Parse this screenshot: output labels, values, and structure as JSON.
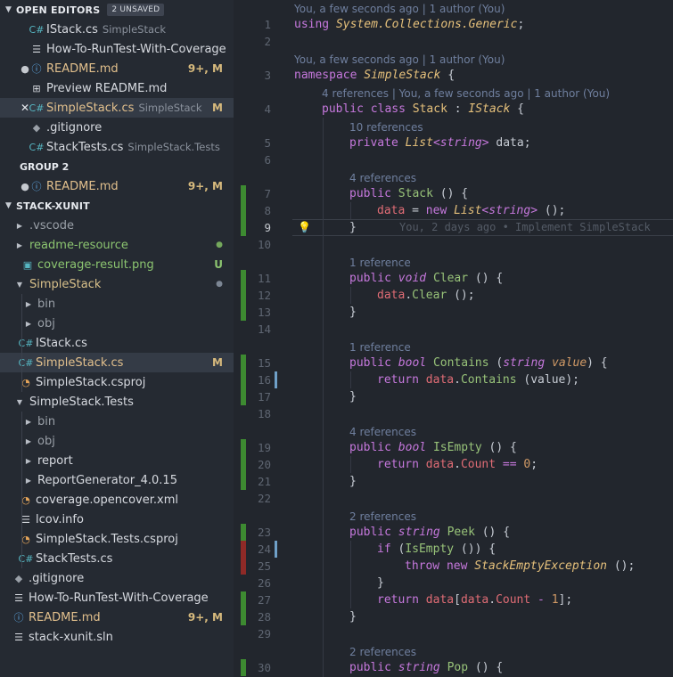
{
  "open_editors": {
    "title": "OPEN EDITORS",
    "badge": "2 UNSAVED",
    "items": [
      {
        "label": "IStack.cs",
        "desc": "SimpleStack",
        "icon": "csharp-icon"
      },
      {
        "label": "How-To-RunTest-With-Coverage",
        "desc": "",
        "icon": "text-file-icon"
      },
      {
        "label": "README.md",
        "desc": "",
        "status": "9+, M",
        "icon": "info-icon"
      },
      {
        "label": "Preview README.md",
        "desc": "",
        "icon": "preview-icon"
      },
      {
        "label": "SimpleStack.cs",
        "desc": "SimpleStack",
        "status": "M",
        "icon": "csharp-icon"
      },
      {
        "label": ".gitignore",
        "desc": "",
        "icon": "git-icon"
      },
      {
        "label": "StackTests.cs",
        "desc": "SimpleStack.Tests",
        "icon": "csharp-icon"
      }
    ],
    "group2": {
      "title": "GROUP 2",
      "items": [
        {
          "label": "README.md",
          "status": "9+, M"
        }
      ]
    }
  },
  "explorer": {
    "title": "STACK-XUNIT",
    "items": [
      {
        "label": ".vscode"
      },
      {
        "label": "readme-resource"
      },
      {
        "label": "coverage-result.png",
        "status": "U"
      },
      {
        "label": "SimpleStack"
      },
      {
        "label": "bin"
      },
      {
        "label": "obj"
      },
      {
        "label": "IStack.cs"
      },
      {
        "label": "SimpleStack.cs",
        "status": "M"
      },
      {
        "label": "SimpleStack.csproj"
      },
      {
        "label": "SimpleStack.Tests"
      },
      {
        "label": "bin"
      },
      {
        "label": "obj"
      },
      {
        "label": "report"
      },
      {
        "label": "ReportGenerator_4.0.15"
      },
      {
        "label": "coverage.opencover.xml"
      },
      {
        "label": "lcov.info"
      },
      {
        "label": "SimpleStack.Tests.csproj"
      },
      {
        "label": "StackTests.cs"
      },
      {
        "label": ".gitignore"
      },
      {
        "label": "How-To-RunTest-With-Coverage"
      },
      {
        "label": "README.md",
        "status": "9+, M"
      },
      {
        "label": "stack-xunit.sln"
      }
    ]
  },
  "editor": {
    "lens": {
      "l1": "You, a few seconds ago | 1 author (You)",
      "l3": "You, a few seconds ago | 1 author (You)",
      "l4": "4 references | You, a few seconds ago | 1 author (You)",
      "l5": "10 references",
      "l7": "4 references",
      "l11": "1 reference",
      "l15": "1 reference",
      "l19": "4 references",
      "l23": "2 references",
      "l30": "2 references"
    },
    "blame9": "You, 2 days ago • Implement SimpleStack",
    "line_numbers": [
      "1",
      "2",
      "3",
      "4",
      "5",
      "6",
      "7",
      "8",
      "9",
      "10",
      "11",
      "12",
      "13",
      "14",
      "15",
      "16",
      "17",
      "18",
      "19",
      "20",
      "21",
      "22",
      "23",
      "24",
      "25",
      "26",
      "27",
      "28",
      "29",
      "30"
    ],
    "code": {
      "l1": [
        "using",
        " ",
        "System.Collections.Generic",
        ";"
      ],
      "l3": [
        "namespace",
        " ",
        "SimpleStack",
        " {"
      ],
      "l4": [
        "public",
        " ",
        "class",
        " ",
        "Stack",
        " : ",
        "IStack",
        " {"
      ],
      "l5": [
        "private",
        " ",
        "List",
        "<",
        "string",
        ">",
        " data;"
      ],
      "l7": [
        "public",
        " ",
        "Stack",
        " () {"
      ],
      "l8": [
        "data",
        " = ",
        "new",
        " ",
        "List",
        "<",
        "string",
        ">",
        " ();"
      ],
      "l9": [
        "}"
      ],
      "l11": [
        "public",
        " ",
        "void",
        " ",
        "Clear",
        " () {"
      ],
      "l12": [
        "data",
        ".",
        "Clear",
        " ();"
      ],
      "l13": [
        "}"
      ],
      "l15": [
        "public",
        " ",
        "bool",
        " ",
        "Contains",
        " (",
        "string",
        " ",
        "value",
        ") {"
      ],
      "l16": [
        "return",
        " ",
        "data",
        ".",
        "Contains",
        " (value);"
      ],
      "l17": [
        "}"
      ],
      "l19": [
        "public",
        " ",
        "bool",
        " ",
        "IsEmpty",
        " () {"
      ],
      "l20": [
        "return",
        " ",
        "data",
        ".",
        "Count",
        " ",
        "==",
        " ",
        "0",
        ";"
      ],
      "l21": [
        "}"
      ],
      "l23": [
        "public",
        " ",
        "string",
        " ",
        "Peek",
        " () {"
      ],
      "l24": [
        "if",
        " (",
        "IsEmpty",
        " ()) {"
      ],
      "l25": [
        "throw",
        " ",
        "new",
        " ",
        "StackEmptyException",
        " ();"
      ],
      "l26": [
        "}"
      ],
      "l27": [
        "return",
        " ",
        "data",
        "[",
        "data",
        ".",
        "Count",
        " ",
        "-",
        " ",
        "1",
        "];"
      ],
      "l28": [
        "}"
      ],
      "l30": [
        "public",
        " ",
        "string",
        " ",
        "Pop",
        " () {"
      ]
    }
  },
  "colors": {
    "sidebar_bg": "#252a32",
    "editor_bg": "#22262d",
    "git_added": "#3d8a31",
    "git_deleted": "#8f2a27",
    "git_modified": "#6fa0c8"
  }
}
